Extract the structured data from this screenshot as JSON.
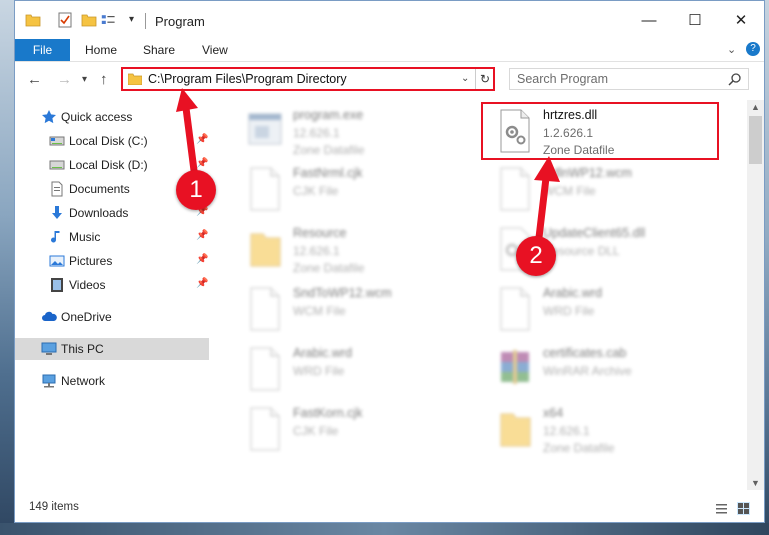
{
  "window": {
    "title": "Program",
    "controls": {
      "minimize": "—",
      "maximize": "☐",
      "close": "✕"
    }
  },
  "ribbon": {
    "tabs": [
      "File",
      "Home",
      "Share",
      "View"
    ],
    "help": "?"
  },
  "nav": {
    "address": "C:\\Program Files\\Program Directory",
    "search_placeholder": "Search Program"
  },
  "sidebar": {
    "items": [
      {
        "label": "Quick access",
        "icon": "star-icon",
        "pinned": false,
        "selected": false
      },
      {
        "label": "Local Disk (C:)",
        "icon": "drive-icon",
        "pinned": true,
        "selected": false
      },
      {
        "label": "Local Disk (D:)",
        "icon": "drive-icon",
        "pinned": true,
        "selected": false
      },
      {
        "label": "Documents",
        "icon": "documents-icon",
        "pinned": true,
        "selected": false
      },
      {
        "label": "Downloads",
        "icon": "downloads-icon",
        "pinned": true,
        "selected": false
      },
      {
        "label": "Music",
        "icon": "music-icon",
        "pinned": true,
        "selected": false
      },
      {
        "label": "Pictures",
        "icon": "pictures-icon",
        "pinned": true,
        "selected": false
      },
      {
        "label": "Videos",
        "icon": "videos-icon",
        "pinned": true,
        "selected": false
      },
      {
        "label": "OneDrive",
        "icon": "cloud-icon",
        "pinned": false,
        "selected": false
      },
      {
        "label": "This PC",
        "icon": "computer-icon",
        "pinned": false,
        "selected": true
      },
      {
        "label": "Network",
        "icon": "network-icon",
        "pinned": false,
        "selected": false
      }
    ]
  },
  "files": [
    {
      "name": "program.exe",
      "line1": "12.626.1",
      "line2": "Zone Datafile",
      "icon": "exe-file-icon",
      "faded": true
    },
    {
      "name": "hrtzres.dll",
      "line1": "1.2.626.1",
      "line2": "Zone Datafile",
      "icon": "dll-file-icon",
      "faded": false,
      "highlighted": true
    },
    {
      "name": "FastNrml.cjk",
      "line1": "CJK File",
      "line2": "",
      "icon": "generic-file-icon",
      "faded": true
    },
    {
      "name": "RdlnWP12.wcm",
      "line1": "WCM File",
      "line2": "",
      "icon": "generic-file-icon",
      "faded": true
    },
    {
      "name": "Resource",
      "line1": "12.626.1",
      "line2": "Zone Datafile",
      "icon": "folder-file-icon",
      "faded": true
    },
    {
      "name": "UpdateClient65.dll",
      "line1": "Resource DLL",
      "line2": "",
      "icon": "dll-file-icon",
      "faded": true
    },
    {
      "name": "SndToWP12.wcm",
      "line1": "WCM File",
      "line2": "",
      "icon": "generic-file-icon",
      "faded": true
    },
    {
      "name": "Arabic.wrd",
      "line1": "WRD File",
      "line2": "",
      "icon": "generic-file-icon",
      "faded": true
    },
    {
      "name": "Arabic.wrd",
      "line1": "WRD File",
      "line2": "",
      "icon": "generic-file-icon",
      "faded": true
    },
    {
      "name": "certificates.cab",
      "line1": "WinRAR Archive",
      "line2": "",
      "icon": "archive-file-icon",
      "faded": true
    },
    {
      "name": "FastKorn.cjk",
      "line1": "CJK File",
      "line2": "",
      "icon": "generic-file-icon",
      "faded": true
    },
    {
      "name": "x64",
      "line1": "12.626.1",
      "line2": "Zone Datafile",
      "icon": "folder-file-icon",
      "faded": true
    }
  ],
  "status": {
    "item_count": "149 items"
  },
  "annotations": {
    "step1": "1",
    "step2": "2",
    "color": "#e81123"
  }
}
